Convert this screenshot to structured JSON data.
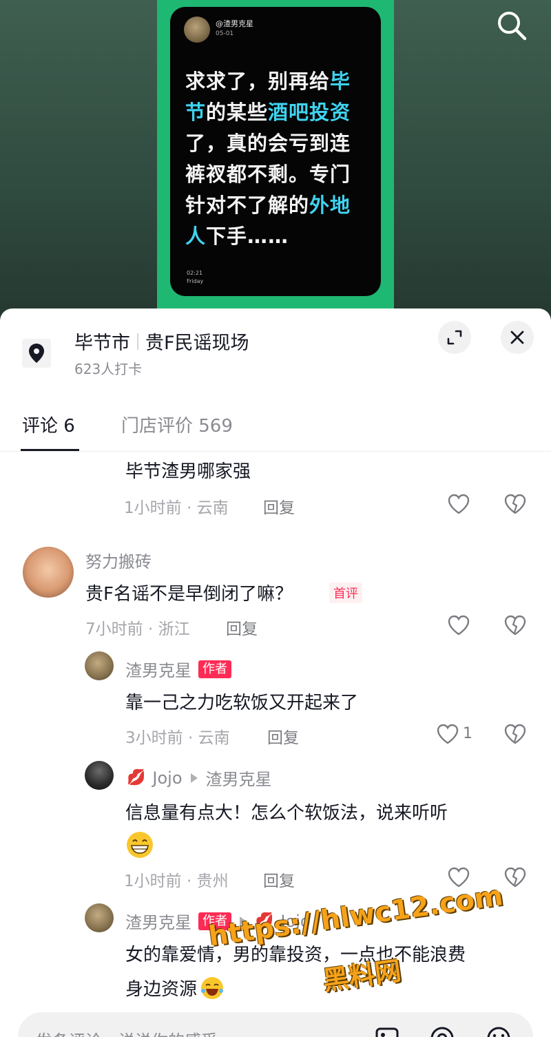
{
  "video": {
    "username": "@渣男克星",
    "date": "05-01",
    "post_lines": [
      [
        {
          "t": "求求了，别再给",
          "h": false
        },
        {
          "t": "毕",
          "h": true
        }
      ],
      [
        {
          "t": "节",
          "h": true
        },
        {
          "t": "的某些",
          "h": false
        },
        {
          "t": "酒吧投资",
          "h": true
        }
      ],
      [
        {
          "t": "了，真的会亏到连",
          "h": false
        }
      ],
      [
        {
          "t": "裤衩都不剩。专门",
          "h": false
        }
      ],
      [
        {
          "t": "针对不了解的",
          "h": false
        },
        {
          "t": "外地",
          "h": true
        }
      ],
      [
        {
          "t": "人",
          "h": true
        },
        {
          "t": "下手……",
          "h": false
        }
      ]
    ],
    "time": "02:21",
    "day": "Friday"
  },
  "location": {
    "city": "毕节市",
    "place": "贵F民谣现场",
    "checkins": "623人打卡"
  },
  "tabs": {
    "comments": "评论 6",
    "store_reviews": "门店评价 569"
  },
  "comments": {
    "c0": {
      "text": "毕节渣男哪家强",
      "meta": "1小时前 · 云南",
      "reply": "回复"
    },
    "c1": {
      "name": "努力搬砖",
      "text": "贵F名谣不是早倒闭了嘛？",
      "badge": "首评",
      "meta": "7小时前 · 浙江",
      "reply": "回复"
    },
    "c2": {
      "name": "渣男克星",
      "author_badge": "作者",
      "text": "靠一己之力吃软饭又开起来了",
      "meta": "3小时前 · 云南",
      "reply": "回复",
      "likes": "1"
    },
    "c3": {
      "name": "Jojo",
      "reply_to": "渣男克星",
      "text": "信息量有点大！怎么个软饭法，说来听听",
      "meta": "1小时前 · 贵州",
      "reply": "回复"
    },
    "c4": {
      "name": "渣男克星",
      "author_badge": "作者",
      "reply_to": "Jojo",
      "line1": "女的靠爱情，男的靠投资，一点也不能浪费",
      "line2": "身边资源"
    }
  },
  "watermark": {
    "url": "https://hlwc12.com",
    "site": "黑料网"
  },
  "input": {
    "placeholder": "发条评论，说说你的感受"
  },
  "colors": {
    "accent": "#fe2c55",
    "highlight": "#3fd3f0",
    "watermark": "#f6a21a"
  }
}
